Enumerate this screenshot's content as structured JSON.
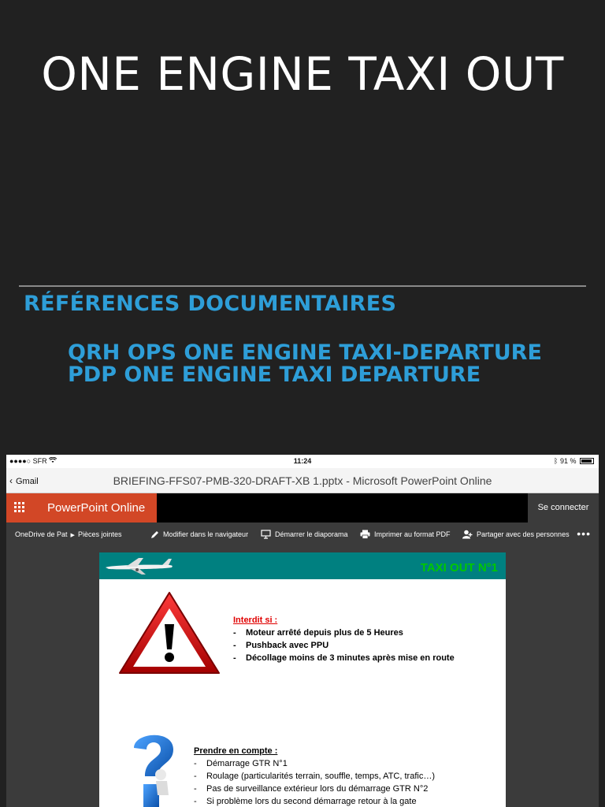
{
  "slide": {
    "title": "ONE ENGINE TAXI OUT",
    "references_heading": "RÉFÉRENCES DOCUMENTAIRES",
    "references": [
      "QRH OPS ONE ENGINE TAXI-DEPARTURE",
      "PDP ONE ENGINE TAXI DEPARTURE"
    ]
  },
  "statusbar": {
    "carrier": "●●●●○ SFR",
    "time": "11:24",
    "battery": "91 %",
    "battery_level": 0.91
  },
  "browser": {
    "back_label": "Gmail",
    "document_title": "BRIEFING-FFS07-PMB-320-DRAFT-XB 1.pptx - Microsoft PowerPoint Online"
  },
  "appbar": {
    "app_name": "PowerPoint Online",
    "signin_label": "Se connecter"
  },
  "commandbar": {
    "breadcrumb_root": "OneDrive de Pat",
    "breadcrumb_leaf": "Pièces jointes",
    "edit_label": "Modifier dans le navigateur",
    "slideshow_label": "Démarrer le diaporama",
    "print_label": "Imprimer au format PDF",
    "share_label": "Partager avec des personnes",
    "more_label": "•••"
  },
  "embedded_slide": {
    "header_title": "TAXI OUT N°1",
    "forbidden": {
      "heading": "Interdit si :",
      "items": [
        "Moteur arrêté depuis plus de 5 Heures",
        "Pushback avec PPU",
        "Décollage moins de 3 minutes après mise en route"
      ]
    },
    "consider": {
      "heading": "Prendre en compte :",
      "items": [
        "Démarrage GTR N°1",
        "Roulage (particularités terrain, souffle, temps, ATC, trafic…)",
        "Pas de surveillance extérieur lors du démarrage GTR N°2",
        "Si problème lors du second démarrage retour à la gate"
      ]
    }
  },
  "colors": {
    "background": "#212121",
    "accent_blue": "#2e9ed8",
    "office_red": "#d24726",
    "slide_header_teal": "#008080",
    "slide_header_text": "#00c800",
    "forbidden_heading": "#e00000"
  }
}
